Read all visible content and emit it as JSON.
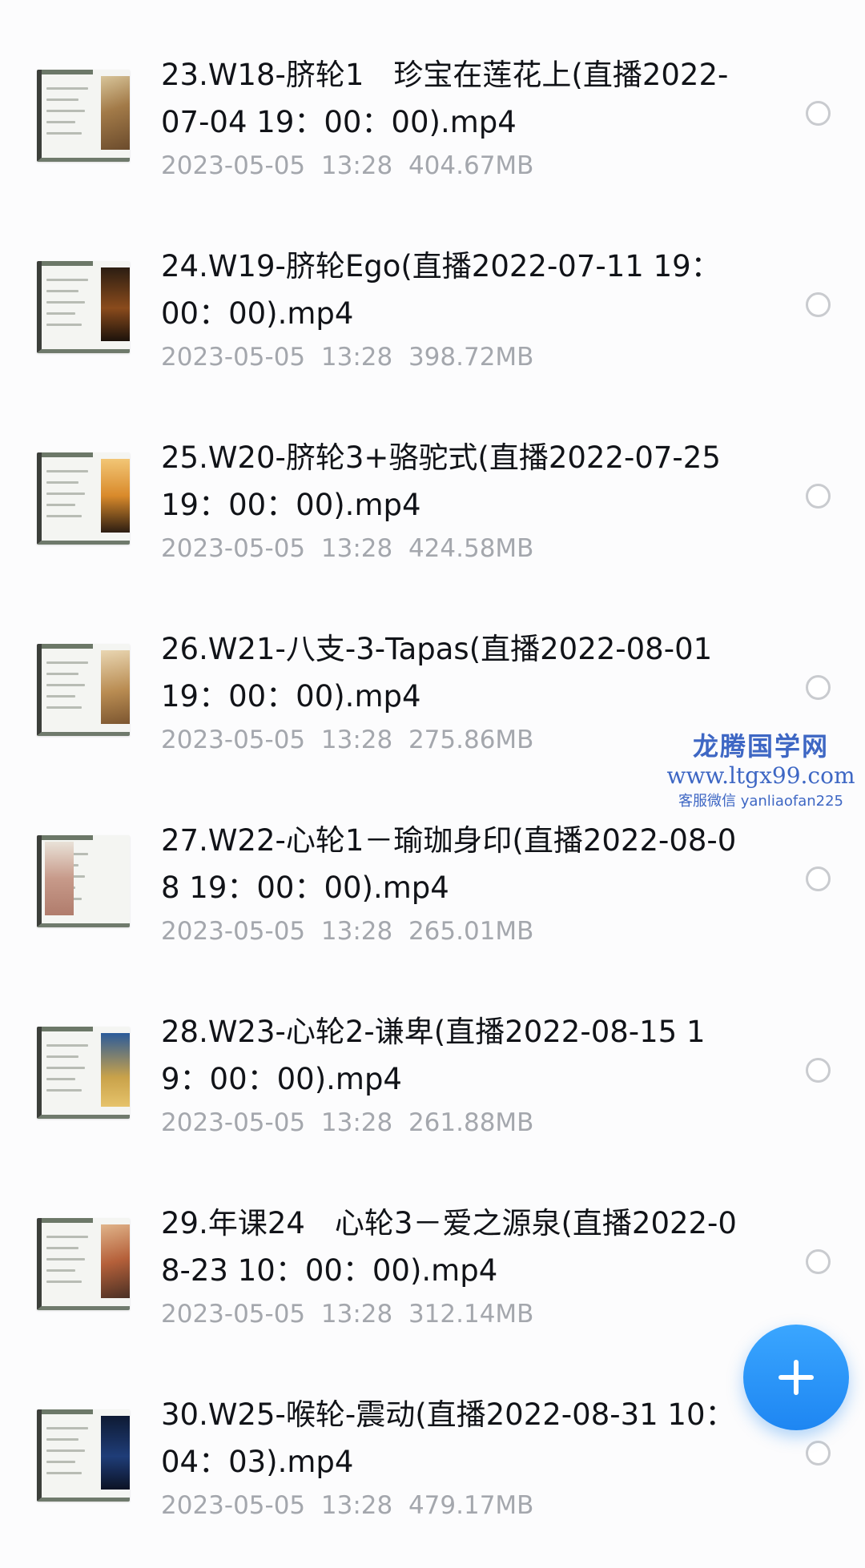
{
  "files": [
    {
      "name": "23.W18-脐轮1　珍宝在莲花上(直播2022-07-04 19：00：00).mp4",
      "date": "2023-05-05",
      "time": "13:28",
      "size": "404.67MB"
    },
    {
      "name": "24.W19-脐轮Ego(直播2022-07-11 19：00：00).mp4",
      "date": "2023-05-05",
      "time": "13:28",
      "size": "398.72MB"
    },
    {
      "name": "25.W20-脐轮3+骆驼式(直播2022-07-25 19：00：00).mp4",
      "date": "2023-05-05",
      "time": "13:28",
      "size": "424.58MB"
    },
    {
      "name": "26.W21-八支-3-Tapas(直播2022-08-01 19：00：00).mp4",
      "date": "2023-05-05",
      "time": "13:28",
      "size": "275.86MB"
    },
    {
      "name": "27.W22-心轮1－瑜珈身印(直播2022-08-08 19：00：00).mp4",
      "date": "2023-05-05",
      "time": "13:28",
      "size": "265.01MB"
    },
    {
      "name": "28.W23-心轮2-谦卑(直播2022-08-15 19：00：00).mp4",
      "date": "2023-05-05",
      "time": "13:28",
      "size": "261.88MB"
    },
    {
      "name": "29.年课24　心轮3－爱之源泉(直播2022-08-23 10：00：00).mp4",
      "date": "2023-05-05",
      "time": "13:28",
      "size": "312.14MB"
    },
    {
      "name": "30.W25-喉轮-震动(直播2022-08-31 10：04：03).mp4",
      "date": "2023-05-05",
      "time": "13:28",
      "size": "479.17MB"
    }
  ],
  "watermark": {
    "title": "龙腾国学网",
    "url": "www.ltgx99.com",
    "contact": "客服微信 yanliaofan225"
  },
  "icons": {
    "fab": "plus-icon",
    "select": "radio-unchecked-icon",
    "thumbnail": "video-thumbnail"
  },
  "colors": {
    "fab": "#1e86f2",
    "title_text": "#111318",
    "meta_text": "#a4a7ad",
    "watermark": "#3e67c4"
  }
}
